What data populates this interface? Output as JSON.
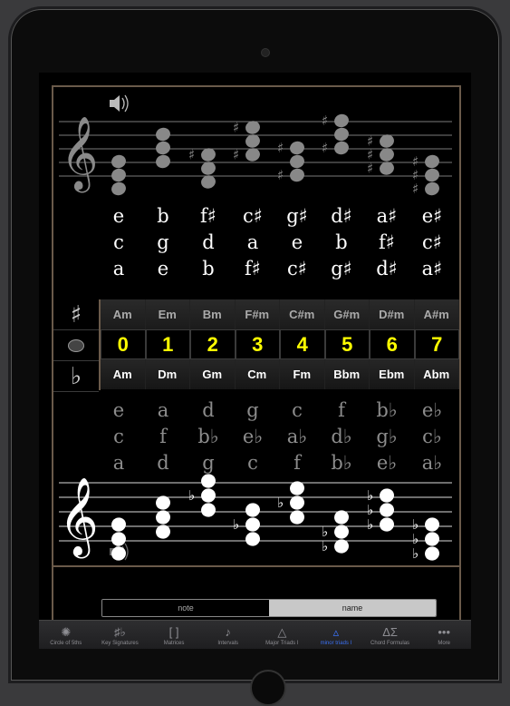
{
  "upper_notes": [
    [
      "e",
      "c",
      "a"
    ],
    [
      "b",
      "g",
      "e"
    ],
    [
      "f♯",
      "d",
      "b"
    ],
    [
      "c♯",
      "a",
      "f♯"
    ],
    [
      "g♯",
      "e",
      "c♯"
    ],
    [
      "d♯",
      "b",
      "g♯"
    ],
    [
      "a♯",
      "f♯",
      "d♯"
    ],
    [
      "e♯",
      "c♯",
      "a♯"
    ]
  ],
  "lower_notes": [
    [
      "e",
      "c",
      "a"
    ],
    [
      "a",
      "f",
      "d"
    ],
    [
      "d",
      "b♭",
      "g"
    ],
    [
      "g",
      "e♭",
      "c"
    ],
    [
      "c",
      "a♭",
      "f"
    ],
    [
      "f",
      "d♭",
      "b♭"
    ],
    [
      "b♭",
      "g♭",
      "e♭"
    ],
    [
      "e♭",
      "c♭",
      "a♭"
    ]
  ],
  "side_symbols": {
    "sharp": "♯",
    "flat": "♭"
  },
  "sharp_minor_keys": [
    "Am",
    "Em",
    "Bm",
    "F#m",
    "C#m",
    "G#m",
    "D#m",
    "A#m"
  ],
  "key_counts": [
    "0",
    "1",
    "2",
    "3",
    "4",
    "5",
    "6",
    "7"
  ],
  "flat_minor_keys": [
    "Am",
    "Dm",
    "Gm",
    "Cm",
    "Fm",
    "Bbm",
    "Ebm",
    "Abm"
  ],
  "segmented": {
    "note": "note",
    "name": "name",
    "selected": "name"
  },
  "tabs": [
    {
      "label": "Circle of 5ths",
      "icon": "circle-icon",
      "glyph": "✺"
    },
    {
      "label": "Key Signatures",
      "icon": "key-signature-icon",
      "glyph": "♯♭"
    },
    {
      "label": "Matrices",
      "icon": "brackets-icon",
      "glyph": "[ ]"
    },
    {
      "label": "Intervals",
      "icon": "note-icon",
      "glyph": "♪"
    },
    {
      "label": "Major Triads I",
      "icon": "triangle-icon",
      "glyph": "△"
    },
    {
      "label": "minor triads I",
      "icon": "small-triangle-icon",
      "glyph": "▵"
    },
    {
      "label": "Chord Formulas",
      "icon": "formula-icon",
      "glyph": "ΔΣ"
    },
    {
      "label": "More",
      "icon": "more-icon",
      "glyph": "•••"
    }
  ],
  "active_tab": "minor triads I",
  "colors": {
    "accent": "#3a6ff0",
    "count": "#ffff00",
    "frame": "#6a5a4a"
  }
}
